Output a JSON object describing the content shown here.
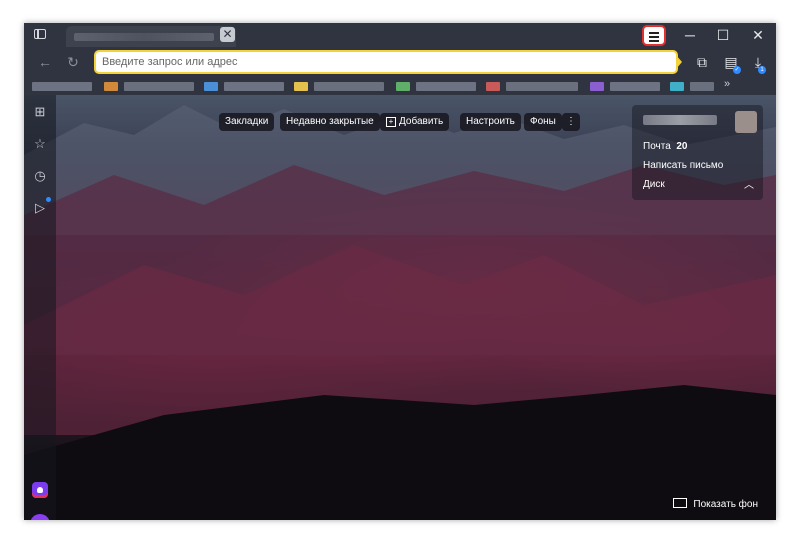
{
  "address_bar": {
    "placeholder": "Введите запрос или адрес"
  },
  "newtab_toolbar": {
    "bookmarks": "Закладки",
    "recently_closed": "Недавно закрытые",
    "add": "Добавить",
    "customize": "Настроить",
    "backgrounds": "Фоны"
  },
  "account_panel": {
    "mail_label": "Почта",
    "mail_count": "20",
    "compose": "Написать письмо",
    "disk": "Диск"
  },
  "footer": {
    "show_background": "Показать фон"
  },
  "icons": {
    "sidebar_toggle": "sidebar-toggle-icon",
    "menu": "hamburger-menu-icon",
    "downloads_badge": "1"
  },
  "colors": {
    "menu_highlight": "#e03030",
    "omnibox_border": "#f3d33a",
    "alice_purple": "#8a3df2"
  }
}
